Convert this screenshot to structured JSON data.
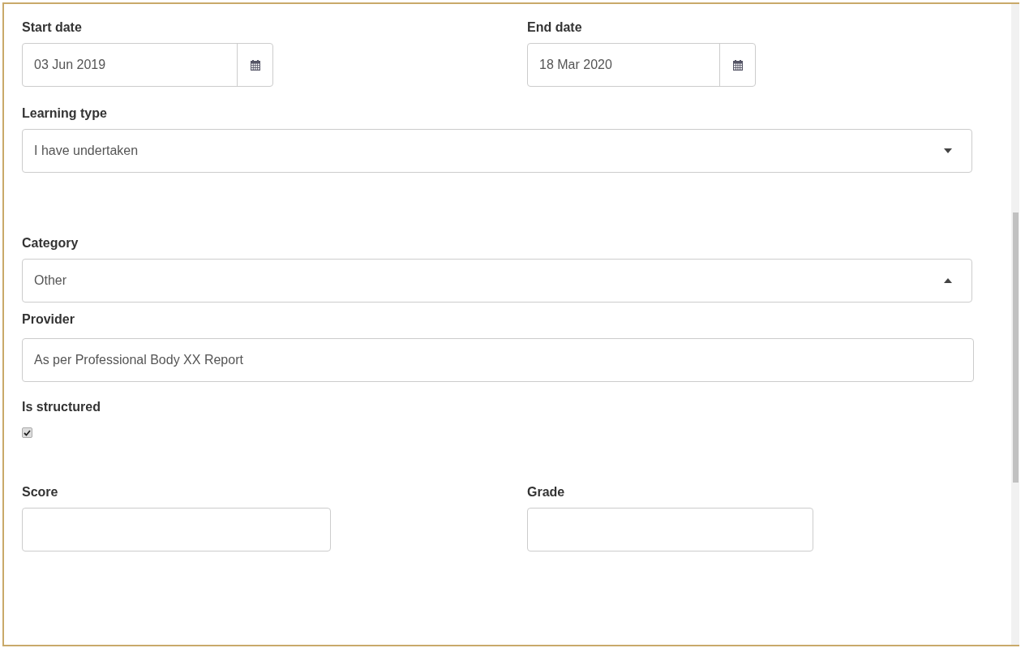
{
  "dates": [
    {
      "label": "Start date",
      "value": "03 Jun 2019"
    },
    {
      "label": "End date",
      "value": "18 Mar 2020"
    }
  ],
  "learning_type": {
    "label": "Learning type",
    "value": "I have undertaken",
    "expanded": false
  },
  "category": {
    "label": "Category",
    "value": "Other",
    "expanded": true
  },
  "provider": {
    "label": "Provider",
    "value": "As per Professional Body XX Report"
  },
  "is_structured": {
    "label": "Is structured",
    "checked": true
  },
  "scores": [
    {
      "label": "Score"
    },
    {
      "label": "Grade"
    }
  ]
}
